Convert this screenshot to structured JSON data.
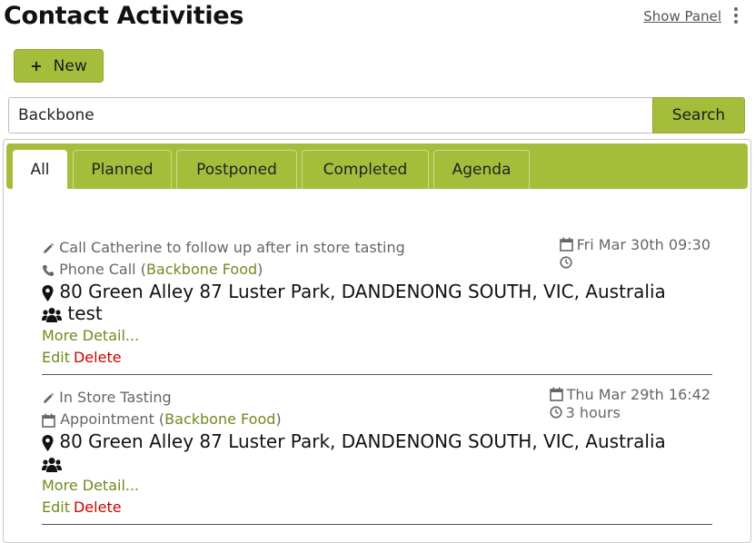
{
  "header": {
    "title": "Contact Activities",
    "show_panel_label": "Show Panel"
  },
  "toolbar": {
    "new_label": "New"
  },
  "search": {
    "value": "Backbone",
    "button_label": "Search"
  },
  "tabs": [
    {
      "label": "All",
      "active": true
    },
    {
      "label": "Planned",
      "active": false
    },
    {
      "label": "Postponed",
      "active": false
    },
    {
      "label": "Completed",
      "active": false
    },
    {
      "label": "Agenda",
      "active": false
    }
  ],
  "activities": [
    {
      "subject": "Call Catherine to follow up after in store tasting",
      "type": "Phone Call",
      "company": "Backbone Food",
      "address": "80 Green Alley 87 Luster Park, DANDENONG SOUTH, VIC, Australia",
      "participants": "test",
      "date": "Fri Mar 30th 09:30",
      "duration": "",
      "more_label": "More Detail...",
      "edit_label": "Edit",
      "delete_label": "Delete"
    },
    {
      "subject": "In Store Tasting",
      "type": "Appointment",
      "company": "Backbone Food",
      "address": "80 Green Alley 87 Luster Park, DANDENONG SOUTH, VIC, Australia",
      "participants": "",
      "date": "Thu Mar 29th 16:42",
      "duration": "3 hours",
      "more_label": "More Detail...",
      "edit_label": "Edit",
      "delete_label": "Delete"
    }
  ],
  "colors": {
    "accent": "#a4be3c",
    "link": "#6f8a1e",
    "danger": "#cc0000"
  }
}
